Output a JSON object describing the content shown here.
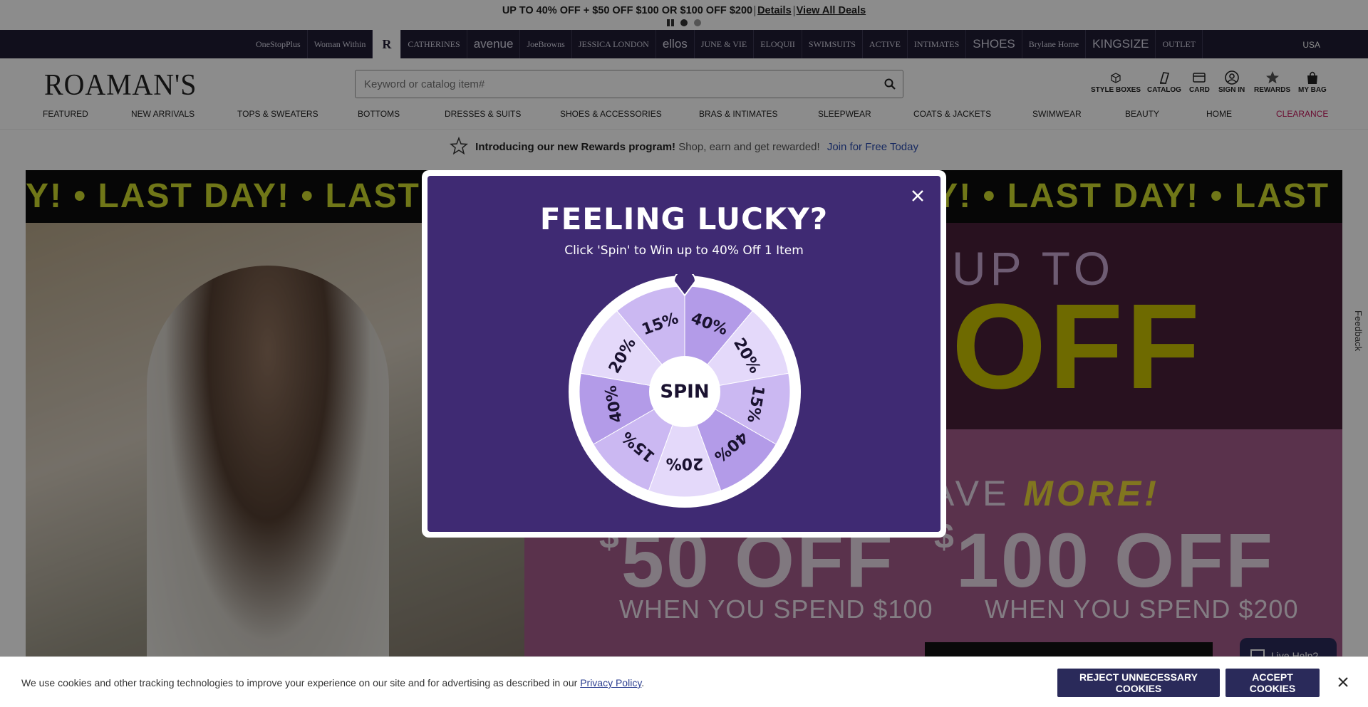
{
  "promo": {
    "headline": "UP TO 40% OFF + $50 OFF $100 OR $100 OFF $200",
    "details_link": "Details",
    "view_all_link": "View All Deals"
  },
  "brands": [
    "OneStopPlus",
    "Woman Within",
    "R",
    "CATHERINES",
    "avenue",
    "JoeBrowns",
    "JESSICA LONDON",
    "ellos",
    "JUNE & VIE",
    "ELOQUII",
    "SWIMSUITS",
    "ACTIVE",
    "INTIMATES",
    "SHOES",
    "Brylane Home",
    "KINGSIZE",
    "OUTLET"
  ],
  "country": "USA",
  "header": {
    "logo": "ROAMAN'S",
    "search_placeholder": "Keyword or catalog item#",
    "utils": [
      "STYLE BOXES",
      "CATALOG",
      "CARD",
      "SIGN IN",
      "REWARDS",
      "MY BAG"
    ]
  },
  "nav": [
    "FEATURED",
    "NEW ARRIVALS",
    "TOPS & SWEATERS",
    "BOTTOMS",
    "DRESSES & SUITS",
    "SHOES & ACCESSORIES",
    "BRAS & INTIMATES",
    "SLEEPWEAR",
    "COATS & JACKETS",
    "SWIMWEAR",
    "BEAUTY",
    "HOME",
    "CLEARANCE"
  ],
  "rewards": {
    "bold": "Introducing our new Rewards program!",
    "text": "Shop, earn and get rewarded!",
    "link": "Join for Free Today"
  },
  "hero": {
    "ticker": "Y! • LAST DAY! • LAST DAY! • LAST DAY! • LAST DAY! • LAST DAY! • LAST DAY! • LAST D",
    "up_to": "UP TO",
    "off": "OFF",
    "save_plain": "AVE",
    "save_em": "MORE!",
    "amount1": "50 OFF",
    "spend1": "WHEN YOU SPEND $100",
    "amount2": "100 OFF",
    "spend2": "WHEN YOU SPEND $200",
    "currency": "$"
  },
  "modal": {
    "title": "FEELING LUCKY?",
    "subtitle": "Click 'Spin' to Win up to 40% Off 1 Item",
    "spin_label": "SPIN",
    "segments": [
      "40%",
      "20%",
      "15%",
      "40%",
      "20%",
      "15%",
      "40%",
      "20%",
      "15%"
    ],
    "colors": {
      "dark": "#b39be8",
      "mid": "#cbb8f2",
      "light": "#e4d9fa",
      "bg": "#3f2a73"
    }
  },
  "cookie": {
    "text": "We use cookies and other tracking technologies to improve your experience on our site and for advertising as described in our",
    "link": "Privacy Policy",
    "period": ".",
    "reject": "REJECT UNNECESSARY COOKIES",
    "accept": "ACCEPT COOKIES"
  },
  "feedback": "Feedback",
  "live_help": "Live Help?"
}
